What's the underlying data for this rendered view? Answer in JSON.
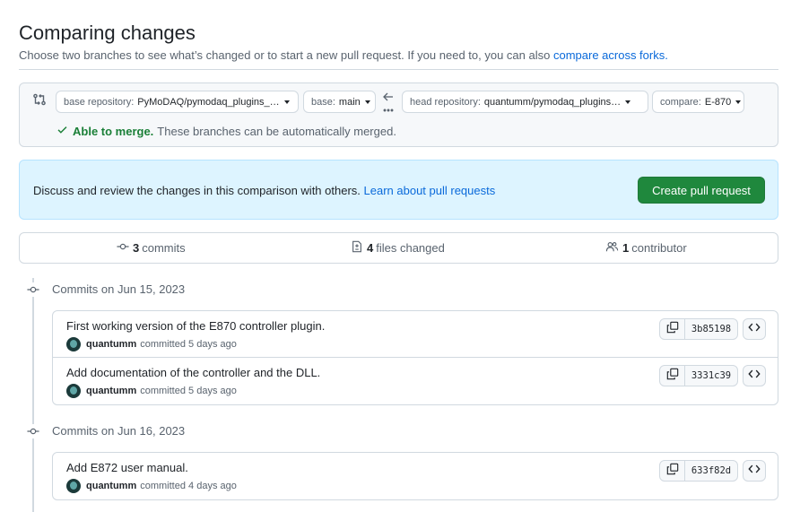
{
  "header": {
    "title": "Comparing changes",
    "subtitle": "Choose two branches to see what’s changed or to start a new pull request. If you need to, you can also ",
    "compare_forks_link": "compare across forks."
  },
  "range": {
    "base_repo_label": "base repository:",
    "base_repo_value": "PyMoDAQ/pymodaq_plugins_…",
    "base_label": "base:",
    "base_value": "main",
    "head_repo_label": "head repository:",
    "head_repo_value": "quantumm/pymodaq_plugins…",
    "compare_label": "compare:",
    "compare_value": "E-870",
    "merge_status": "Able to merge.",
    "merge_detail": "These branches can be automatically merged."
  },
  "flash": {
    "text": "Discuss and review the changes in this comparison with others. ",
    "link": "Learn about pull requests",
    "button": "Create pull request"
  },
  "summary": {
    "commits_count": "3",
    "commits_label": "commits",
    "files_count": "4",
    "files_label": "files changed",
    "contributors_count": "1",
    "contributors_label": "contributor"
  },
  "timeline": [
    {
      "heading": "Commits on Jun 15, 2023",
      "commits": [
        {
          "title": "First working version of the E870 controller plugin.",
          "author": "quantumm",
          "action": "committed",
          "when": "5 days ago",
          "sha": "3b85198"
        },
        {
          "title": "Add documentation of the controller and the DLL.",
          "author": "quantumm",
          "action": "committed",
          "when": "5 days ago",
          "sha": "3331c39"
        }
      ]
    },
    {
      "heading": "Commits on Jun 16, 2023",
      "commits": [
        {
          "title": "Add E872 user manual.",
          "author": "quantumm",
          "action": "committed",
          "when": "4 days ago",
          "sha": "633f82d"
        }
      ]
    }
  ],
  "colors": {
    "accent": "#0969da",
    "success": "#1a7f37",
    "primary_button": "#1f883d",
    "flash_bg": "#ddf4ff"
  }
}
